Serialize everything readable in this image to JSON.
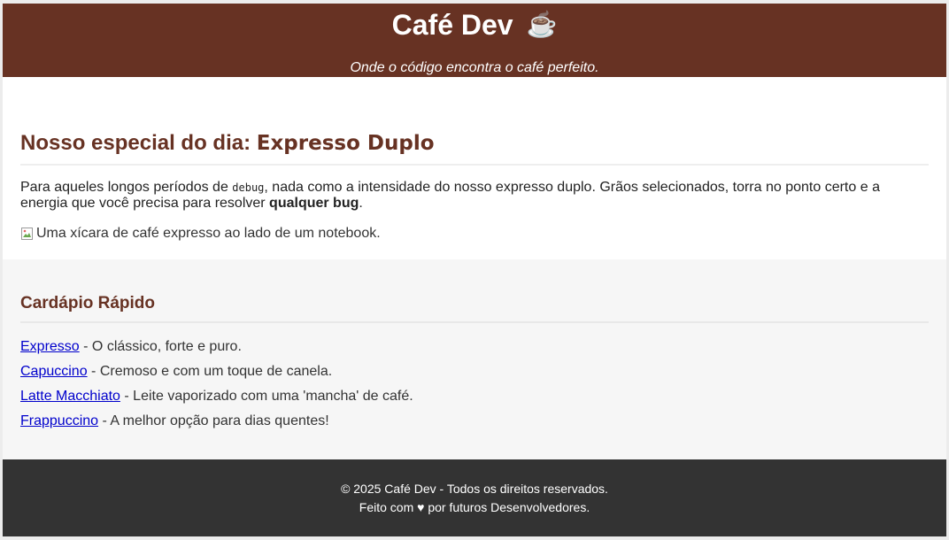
{
  "header": {
    "title": "Café Dev",
    "title_icon": "coffee-cup-icon",
    "tagline": "Onde o código encontra o café perfeito."
  },
  "special": {
    "heading_prefix": "Nosso especial do dia: ",
    "heading_dish": "Expresso Duplo",
    "desc_part1": "Para aqueles longos períodos de ",
    "desc_code": "debug",
    "desc_part2": ", nada como a intensidade do nosso expresso duplo. Grãos selecionados, torra no ponto certo e a energia que você precisa para resolver ",
    "desc_bold": "qualquer bug",
    "desc_end": ".",
    "image_alt": "Uma xícara de café expresso ao lado de um notebook."
  },
  "menu": {
    "heading": "Cardápio Rápido",
    "items": [
      {
        "name": "Expresso",
        "desc": " - O clássico, forte e puro."
      },
      {
        "name": "Capuccino",
        "desc": " - Cremoso e com um toque de canela."
      },
      {
        "name": "Latte Macchiato",
        "desc": " - Leite vaporizado com uma 'mancha' de café."
      },
      {
        "name": "Frappuccino",
        "desc": " - A melhor opção para dias quentes!"
      }
    ]
  },
  "footer": {
    "copyright": "© 2025 Café Dev - Todos os direitos reservados.",
    "made_with": "Feito com ♥ por futuros Desenvolvedores."
  },
  "colors": {
    "brand_brown": "#673223",
    "footer_bg": "#333333",
    "menu_bg": "#f6f6f6",
    "link": "#0000cc"
  }
}
